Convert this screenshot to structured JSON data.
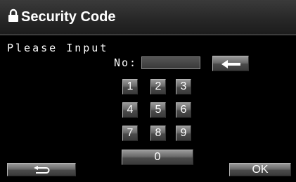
{
  "header": {
    "title": "Security Code",
    "icon": "lock-icon"
  },
  "prompt": "Please Input",
  "code_field": {
    "label": "No:",
    "value": ""
  },
  "keypad": {
    "keys": [
      "1",
      "2",
      "3",
      "4",
      "5",
      "6",
      "7",
      "8",
      "9",
      "0"
    ]
  },
  "buttons": {
    "backspace_icon": "left-arrow-icon",
    "return_icon": "return-arrow-icon",
    "ok_label": "OK"
  },
  "colors": {
    "background": "#000000",
    "button_face": "#6a6a6a",
    "text": "#ffffff"
  }
}
